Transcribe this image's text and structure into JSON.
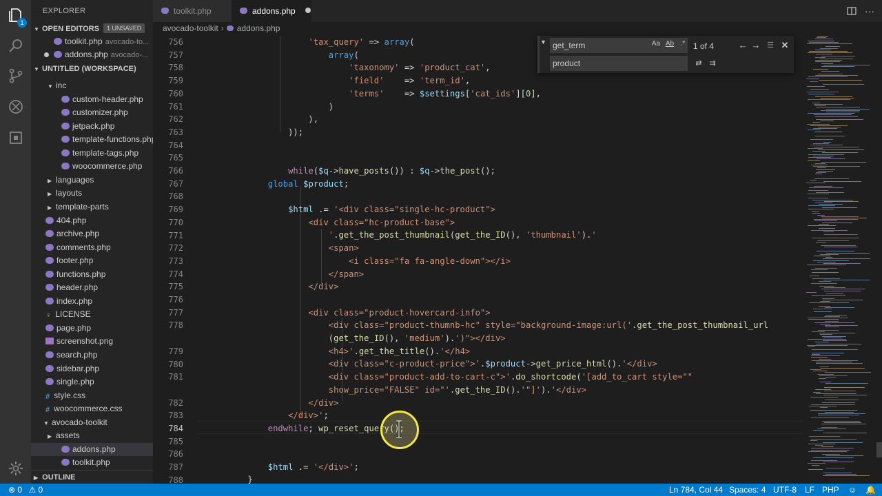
{
  "explorer": {
    "title": "EXPLORER",
    "open_editors": {
      "label": "OPEN EDITORS",
      "badge": "1 UNSAVED",
      "items": [
        {
          "name": "toolkit.php",
          "desc": "avocado-to..."
        },
        {
          "name": "addons.php",
          "desc": "avocado-..."
        }
      ]
    },
    "workspace": {
      "label": "UNTITLED (WORKSPACE)",
      "items": [
        {
          "name": "inc",
          "kind": "folder-open"
        },
        {
          "name": "custom-header.php",
          "kind": "php"
        },
        {
          "name": "customizer.php",
          "kind": "php"
        },
        {
          "name": "jetpack.php",
          "kind": "php"
        },
        {
          "name": "template-functions.php",
          "kind": "php"
        },
        {
          "name": "template-tags.php",
          "kind": "php"
        },
        {
          "name": "woocommerce.php",
          "kind": "php"
        },
        {
          "name": "languages",
          "kind": "folder"
        },
        {
          "name": "layouts",
          "kind": "folder"
        },
        {
          "name": "template-parts",
          "kind": "folder"
        },
        {
          "name": "404.php",
          "kind": "php"
        },
        {
          "name": "archive.php",
          "kind": "php"
        },
        {
          "name": "comments.php",
          "kind": "php"
        },
        {
          "name": "footer.php",
          "kind": "php"
        },
        {
          "name": "functions.php",
          "kind": "php"
        },
        {
          "name": "header.php",
          "kind": "php"
        },
        {
          "name": "index.php",
          "kind": "php"
        },
        {
          "name": "LICENSE",
          "kind": "license"
        },
        {
          "name": "page.php",
          "kind": "php"
        },
        {
          "name": "screenshot.png",
          "kind": "png"
        },
        {
          "name": "search.php",
          "kind": "php"
        },
        {
          "name": "sidebar.php",
          "kind": "php"
        },
        {
          "name": "single.php",
          "kind": "php"
        },
        {
          "name": "style.css",
          "kind": "css"
        },
        {
          "name": "woocommerce.css",
          "kind": "css"
        },
        {
          "name": "avocado-toolkit",
          "kind": "folder-open"
        },
        {
          "name": "assets",
          "kind": "folder"
        },
        {
          "name": "addons.php",
          "kind": "php"
        },
        {
          "name": "toolkit.php",
          "kind": "php"
        }
      ]
    },
    "outline_label": "OUTLINE"
  },
  "tabs": [
    {
      "label": "toolkit.php"
    },
    {
      "label": "addons.php"
    }
  ],
  "breadcrumb": [
    "avocado-toolkit",
    "addons.php"
  ],
  "find_widget": {
    "find_value": "get_term",
    "replace_value": "product",
    "count": "1 of 4",
    "opt_case": "Aa",
    "opt_word": "Ab",
    "opt_regex": ".*"
  },
  "line_numbers": [
    "756",
    "757",
    "758",
    "759",
    "760",
    "761",
    "762",
    "763",
    "764",
    "765",
    "766",
    "767",
    "768",
    "769",
    "770",
    "771",
    "772",
    "773",
    "774",
    "775",
    "776",
    "777",
    "778",
    "",
    "779",
    "780",
    "781",
    "",
    "782",
    "783",
    "784",
    "785",
    "786",
    "787",
    "788"
  ],
  "current_line": "784",
  "status": {
    "errors": "0",
    "warnings": "0",
    "position": "Ln 784, Col 44",
    "spaces": "Spaces: 4",
    "encoding": "UTF-8",
    "eol": "LF",
    "language": "PHP"
  },
  "colors": {
    "accent": "#007acc",
    "editor_bg": "#1e1e1e",
    "sidebar_bg": "#252526"
  }
}
